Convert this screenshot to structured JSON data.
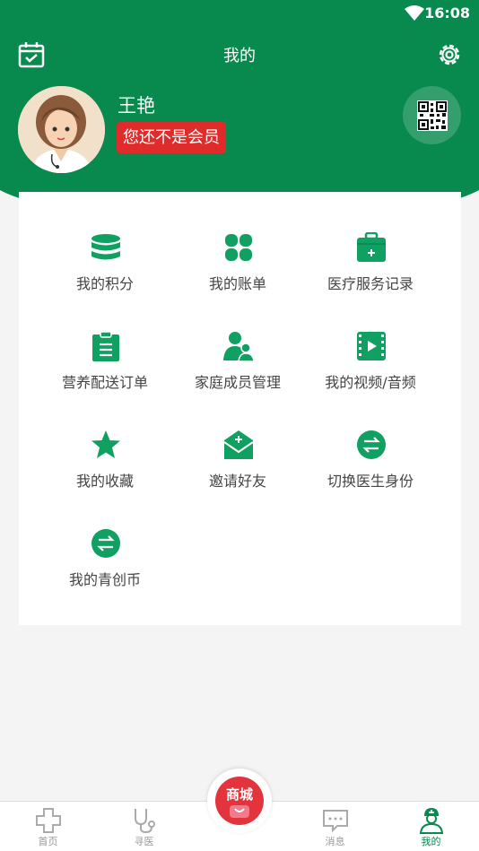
{
  "status_bar": {
    "time": "16:08"
  },
  "header": {
    "title": "我的"
  },
  "profile": {
    "name": "王艳",
    "member_status": "您还不是会员"
  },
  "colors": {
    "brand_green": "#088a4e",
    "badge_red": "#e02b2b",
    "shop_red": "#e3343d"
  },
  "menu": {
    "items": [
      {
        "label": "我的积分",
        "icon": "coins-stack-icon"
      },
      {
        "label": "我的账单",
        "icon": "bill-grid-icon"
      },
      {
        "label": "医疗服务记录",
        "icon": "medical-kit-icon"
      },
      {
        "label": "营养配送订单",
        "icon": "clipboard-icon"
      },
      {
        "label": "家庭成员管理",
        "icon": "family-icon"
      },
      {
        "label": "我的视频/音频",
        "icon": "video-icon"
      },
      {
        "label": "我的收藏",
        "icon": "star-icon"
      },
      {
        "label": "邀请好友",
        "icon": "invite-mail-icon"
      },
      {
        "label": "切换医生身份",
        "icon": "switch-icon"
      },
      {
        "label": "我的青创币",
        "icon": "switch-icon"
      }
    ]
  },
  "bottom_nav": {
    "items": [
      {
        "label": "首页",
        "icon": "home-cross-icon",
        "active": false
      },
      {
        "label": "寻医",
        "icon": "stethoscope-icon",
        "active": false
      },
      {
        "label": "消息",
        "icon": "message-icon",
        "active": false
      },
      {
        "label": "我的",
        "icon": "nurse-icon",
        "active": true
      }
    ],
    "shop_label": "商城"
  }
}
